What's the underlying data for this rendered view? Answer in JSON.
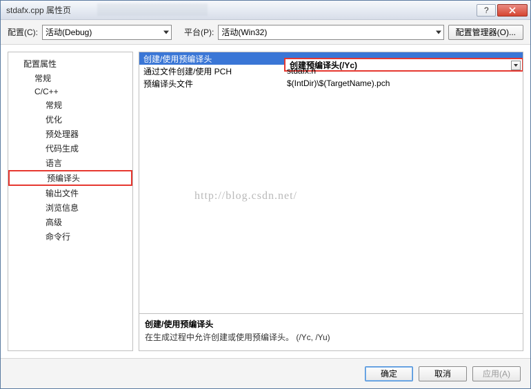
{
  "window": {
    "title": "stdafx.cpp 属性页"
  },
  "toolbar": {
    "config_label": "配置(C):",
    "config_value": "活动(Debug)",
    "platform_label": "平台(P):",
    "platform_value": "活动(Win32)",
    "config_mgr": "配置管理器(O)..."
  },
  "tree": {
    "root": "配置属性",
    "general": "常规",
    "cc": "C/C++",
    "items": [
      "常规",
      "优化",
      "预处理器",
      "代码生成",
      "语言",
      "预编译头",
      "输出文件",
      "浏览信息",
      "高级",
      "命令行"
    ],
    "highlight": "预编译头"
  },
  "grid": {
    "rows": [
      {
        "name": "创建/使用预编译头",
        "value": "创建预编译头(/Yc)",
        "selected": true,
        "dropdown": true
      },
      {
        "name": "通过文件创建/使用 PCH",
        "value": "stdafx.h"
      },
      {
        "name": "预编译头文件",
        "value": "$(IntDir)\\$(TargetName).pch"
      }
    ]
  },
  "desc": {
    "title": "创建/使用预编译头",
    "body": "在生成过程中允许创建或使用预编译头。     (/Yc, /Yu)"
  },
  "footer": {
    "ok": "确定",
    "cancel": "取消",
    "apply": "应用(A)"
  },
  "watermark": "http://blog.csdn.net/"
}
